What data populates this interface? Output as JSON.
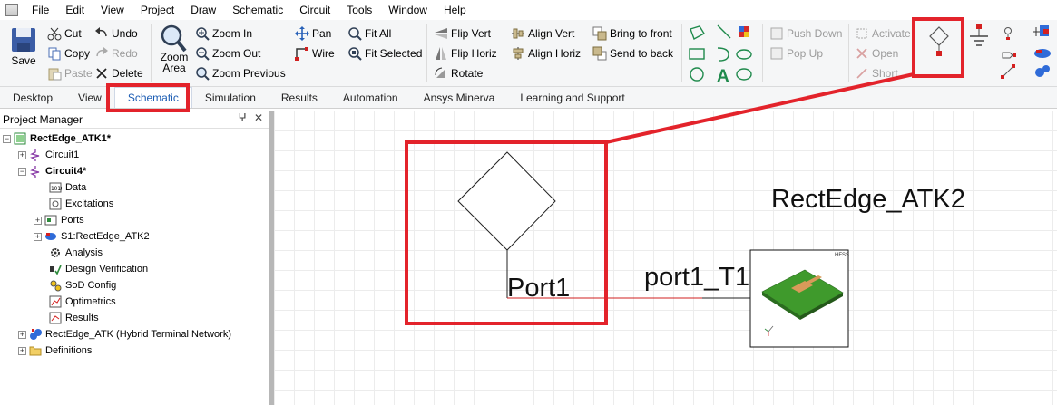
{
  "menubar": {
    "items": [
      "File",
      "Edit",
      "View",
      "Project",
      "Draw",
      "Schematic",
      "Circuit",
      "Tools",
      "Window",
      "Help"
    ]
  },
  "ribbon": {
    "save": "Save",
    "cut": "Cut",
    "copy": "Copy",
    "paste": "Paste",
    "undo": "Undo",
    "redo": "Redo",
    "delete": "Delete",
    "zoom_area_1": "Zoom",
    "zoom_area_2": "Area",
    "zoom_in": "Zoom In",
    "zoom_out": "Zoom Out",
    "zoom_previous": "Zoom Previous",
    "pan": "Pan",
    "wire": "Wire",
    "fit_all": "Fit All",
    "fit_selected": "Fit Selected",
    "flip_vert": "Flip Vert",
    "flip_horiz": "Flip Horiz",
    "rotate": "Rotate",
    "align_vert": "Align Vert",
    "align_horiz": "Align Horiz",
    "bring_to_front": "Bring to front",
    "send_to_back": "Send to back",
    "push_down": "Push Down",
    "pop_up": "Pop Up",
    "activate": "Activate",
    "open": "Open",
    "short": "Short"
  },
  "tabs": [
    "Desktop",
    "View",
    "Schematic",
    "Simulation",
    "Results",
    "Automation",
    "Ansys Minerva",
    "Learning and Support"
  ],
  "project_manager": {
    "title": "Project Manager",
    "pin": "ꟷ",
    "close": "✕",
    "tree": [
      {
        "label": "RectEdge_ATK1*",
        "bold": true
      },
      {
        "label": "Circuit1"
      },
      {
        "label": "Circuit4*",
        "bold": true
      },
      {
        "label": "Data"
      },
      {
        "label": "Excitations"
      },
      {
        "label": "Ports"
      },
      {
        "label": "S1:RectEdge_ATK2"
      },
      {
        "label": "Analysis"
      },
      {
        "label": "Design Verification"
      },
      {
        "label": "SoD Config"
      },
      {
        "label": "Optimetrics"
      },
      {
        "label": "Results"
      },
      {
        "label": "RectEdge_ATK (Hybrid Terminal Network)"
      },
      {
        "label": "Definitions"
      }
    ]
  },
  "canvas": {
    "component_title": "RectEdge_ATK2",
    "port_label": "Port1",
    "net_label": "port1_T1",
    "wire_color": "#d02020",
    "highlight_color": "#e3232b"
  }
}
